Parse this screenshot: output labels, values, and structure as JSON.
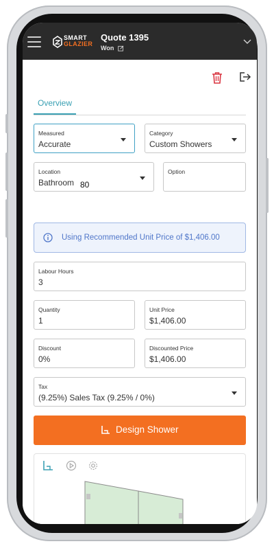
{
  "app": {
    "logo_line1": "SMART",
    "logo_line2": "GLAZIER",
    "title": "Quote 1395",
    "status": "Won"
  },
  "tabs": [
    {
      "label": "Overview",
      "active": true
    }
  ],
  "form": {
    "measured": {
      "label": "Measured",
      "value": "Accurate"
    },
    "category": {
      "label": "Category",
      "value": "Custom Showers"
    },
    "location": {
      "label": "Location",
      "value": "Bathroom"
    },
    "option": {
      "label": "Option",
      "value": ""
    },
    "info_message": "Using Recommended Unit Price of $1,406.00",
    "labour_hours": {
      "label": "Labour Hours",
      "value": "3"
    },
    "quantity": {
      "label": "Quantity",
      "value": "1"
    },
    "unit_price": {
      "label": "Unit Price",
      "value": "$1,406.00"
    },
    "discount": {
      "label": "Discount",
      "value": "0%"
    },
    "discounted_price": {
      "label": "Discounted Price",
      "value": "$1,406.00"
    },
    "tax": {
      "label": "Tax",
      "value": "(9.25%) Sales Tax (9.25% / 0%)"
    }
  },
  "design_button": {
    "label": "Design Shower"
  },
  "preview": {
    "dimension_label": "80"
  },
  "icons": {
    "menu": "hamburger-icon",
    "edit": "edit-icon",
    "expand": "chevron-down-icon",
    "delete": "trash-icon",
    "exit": "exit-icon",
    "info": "info-icon",
    "shower": "shower-corner-icon",
    "play": "play-icon",
    "settings": "gear-icon"
  },
  "colors": {
    "accent": "#3aa0b3",
    "brand_orange": "#f36f21",
    "delete_red": "#d9333f",
    "info_blue": "#4f76c9",
    "appbar": "#2b2b2b",
    "glass": "#d7ecd6"
  }
}
